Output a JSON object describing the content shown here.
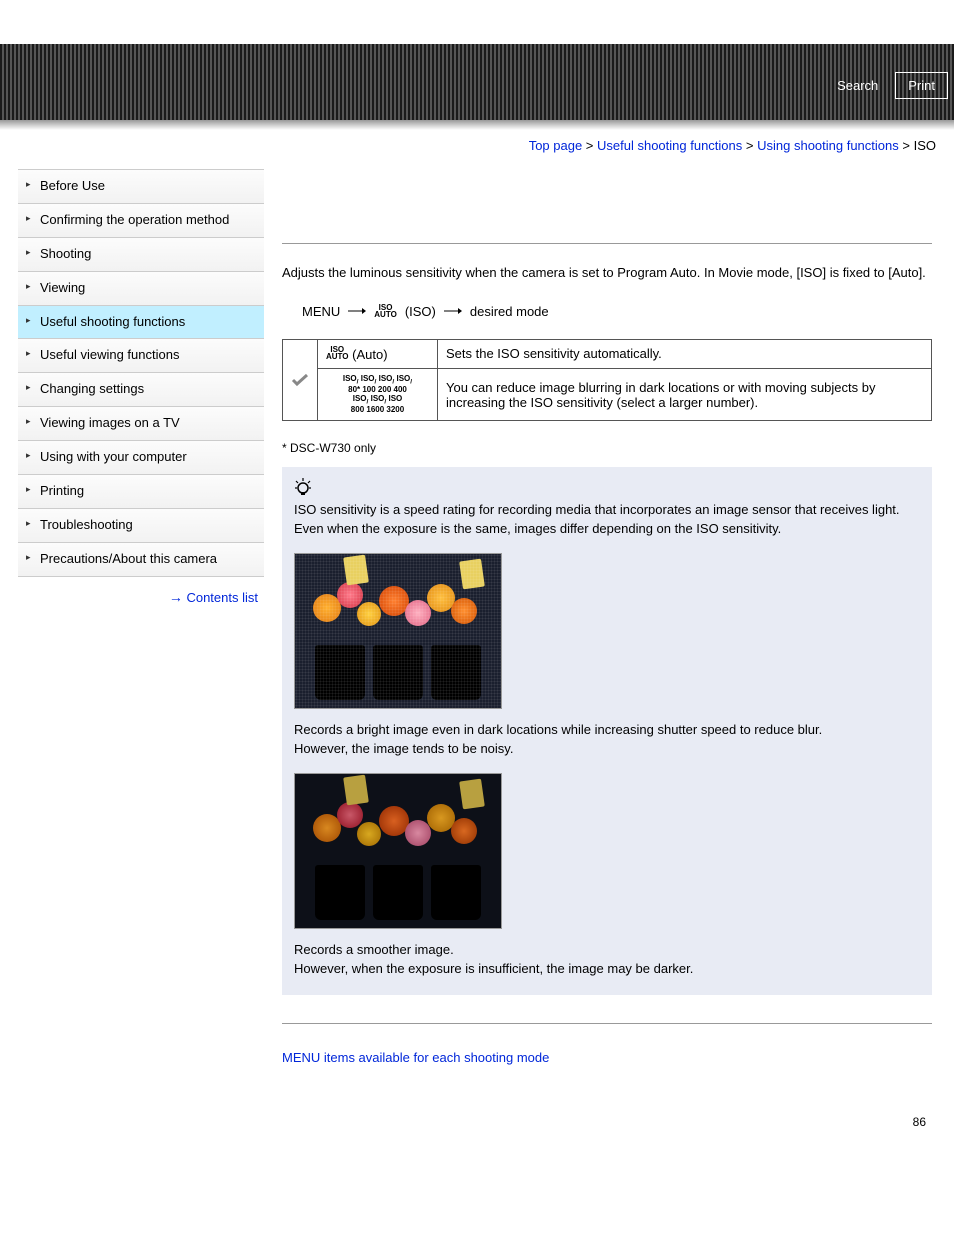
{
  "header": {
    "search": "Search",
    "print": "Print"
  },
  "breadcrumb": {
    "top": "Top page",
    "level2": "Useful shooting functions",
    "level3": "Using shooting functions",
    "current": "ISO",
    "sep": " > "
  },
  "sidebar": {
    "items": [
      "Before Use",
      "Confirming the operation method",
      "Shooting",
      "Viewing",
      "Useful shooting functions",
      "Useful viewing functions",
      "Changing settings",
      "Viewing images on a TV",
      "Using with your computer",
      "Printing",
      "Troubleshooting",
      "Precautions/About this camera"
    ],
    "active_index": 4,
    "contents_link": "Contents list"
  },
  "main": {
    "intro": "Adjusts the luminous sensitivity when the camera is set to Program Auto. In Movie mode, [ISO] is fixed to [Auto].",
    "menu_label": "MENU",
    "iso_label": "(ISO)",
    "desired": "desired mode",
    "table": {
      "row1_label": "(Auto)",
      "row1_desc": "Sets the ISO sensitivity automatically.",
      "row2_labels": "ISO 80*/ ISO 100/ ISO 200/ ISO 400/ ISO 800/ ISO 1600/ ISO 3200",
      "row2_desc": "You can reduce image blurring in dark locations or with moving subjects by increasing the ISO sensitivity (select a larger number)."
    },
    "footnote": "* DSC-W730 only",
    "tip": {
      "intro": "ISO sensitivity is a speed rating for recording media that incorporates an image sensor that receives light. Even when the exposure is the same, images differ depending on the ISO sensitivity.",
      "photo1_desc_l1": "Records a bright image even in dark locations while increasing shutter speed to reduce blur.",
      "photo1_desc_l2": "However, the image tends to be noisy.",
      "photo2_desc_l1": "Records a smoother image.",
      "photo2_desc_l2": "However, when the exposure is insufficient, the image may be darker."
    },
    "related": "MENU items available for each shooting mode",
    "pagenum": "86"
  }
}
